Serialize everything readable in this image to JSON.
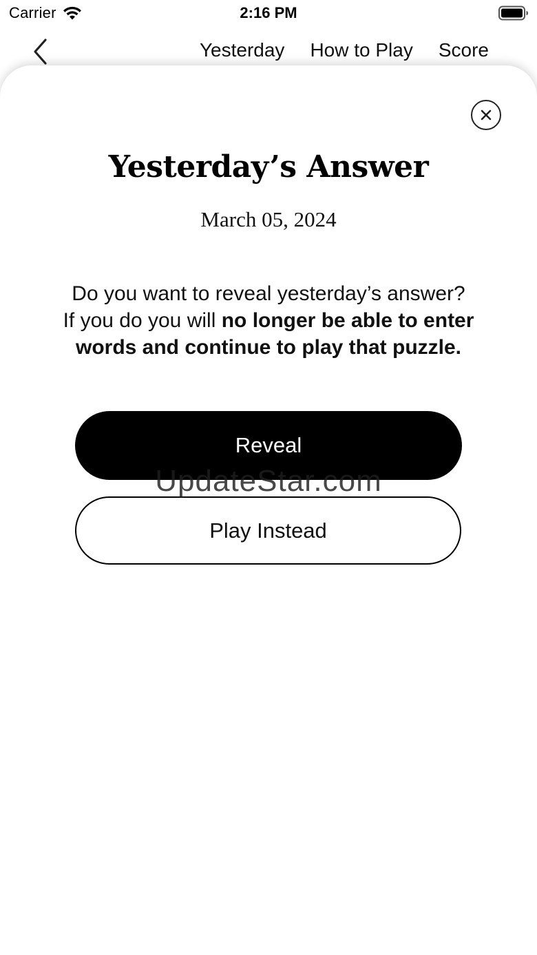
{
  "status_bar": {
    "carrier": "Carrier",
    "time": "2:16 PM",
    "icons": [
      "wifi-icon",
      "battery-icon"
    ]
  },
  "nav": {
    "back_icon": "chevron-left-icon",
    "links": [
      "Yesterday",
      "How to Play",
      "Score"
    ]
  },
  "sheet": {
    "close_icon": "close-icon",
    "title": "Yesterday’s Answer",
    "date": "March 05, 2024",
    "message": {
      "line1": "Do you want to reveal yesterday’s answer?",
      "line2_prefix": "If you do you will",
      "line2_bold": "no longer be able to enter words and continue to play that puzzle."
    },
    "reveal_label": "Reveal",
    "play_instead_label": "Play Instead"
  },
  "watermark": "UpdateStar.com",
  "colors": {
    "primary_button": "#000000",
    "primary_text": "#ffffff",
    "background": "#ffffff"
  }
}
